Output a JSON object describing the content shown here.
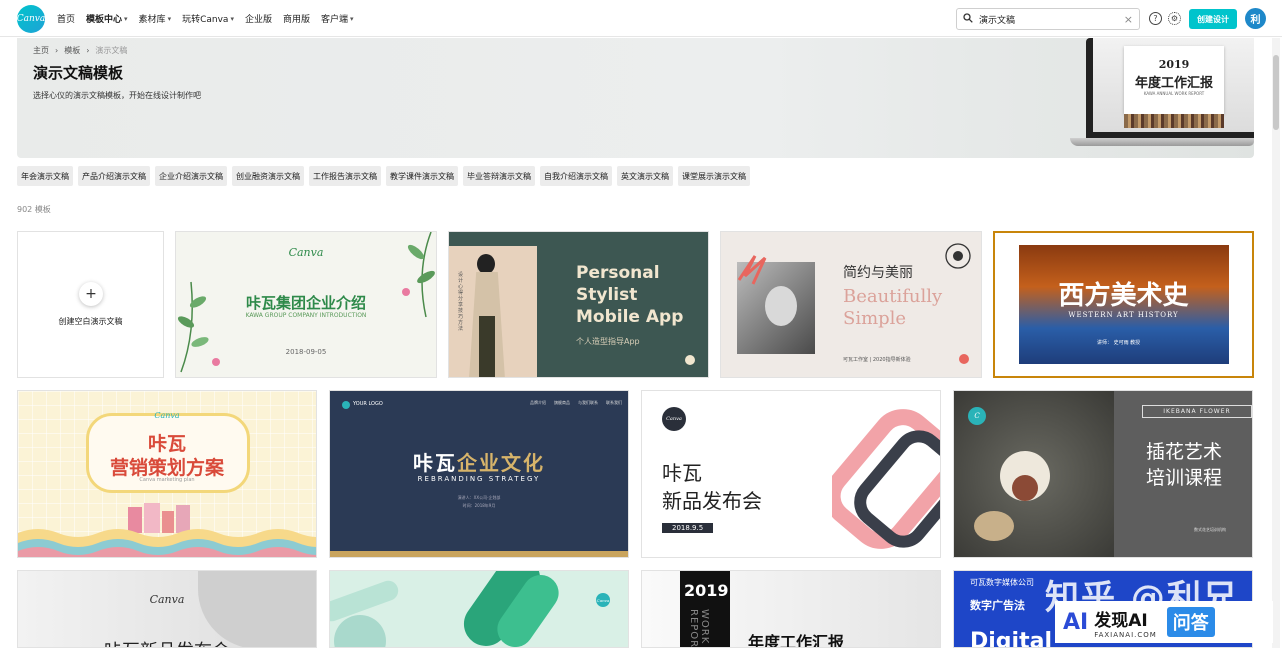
{
  "nav": {
    "logo_text": "Canva",
    "items": [
      {
        "label": "首页",
        "has_chevron": false
      },
      {
        "label": "模板中心",
        "has_chevron": true,
        "active": true
      },
      {
        "label": "素材库",
        "has_chevron": true
      },
      {
        "label": "玩转Canva",
        "has_chevron": true
      },
      {
        "label": "企业版",
        "has_chevron": false
      },
      {
        "label": "商用版",
        "has_chevron": false
      },
      {
        "label": "客户端",
        "has_chevron": true
      }
    ],
    "search_value": "演示文稿",
    "create_button": "创建设计",
    "avatar_initial": "利"
  },
  "hero": {
    "breadcrumbs": [
      "主页",
      "模板",
      "演示文稿"
    ],
    "title": "演示文稿模板",
    "subtitle": "选择心仪的演示文稿模板，开始在线设计制作吧",
    "laptop_year": "2019",
    "laptop_title": "年度工作汇报",
    "laptop_sub": "KAWA ANNUAL WORK REPORT"
  },
  "tags": [
    "年会演示文稿",
    "产品介绍演示文稿",
    "企业介绍演示文稿",
    "创业融资演示文稿",
    "工作报告演示文稿",
    "教学课件演示文稿",
    "毕业答辩演示文稿",
    "自我介绍演示文稿",
    "英文演示文稿",
    "课堂展示演示文稿"
  ],
  "result_count": "902 模板",
  "blank_card": {
    "label": "创建空白演示文稿",
    "plus": "+"
  },
  "cards": {
    "c1": {
      "brand": "Canva",
      "title": "咔瓦集团企业介绍",
      "sub": "KAWA GROUP COMPANY INTRODUCTION",
      "date": "2018-09-05"
    },
    "c2": {
      "title_lines": [
        "Personal",
        "Stylist",
        "Mobile App"
      ],
      "sub": "个人造型指导App",
      "side": "设计心得分享技巧方法"
    },
    "c3": {
      "title_cn": "简约与美丽",
      "title_en1": "Beautifully",
      "title_en2": "Simple",
      "footer": "可瓦工作室 | 2020指导新体验"
    },
    "c4": {
      "title": "西方美术史",
      "sub": "WESTERN ART HISTORY",
      "footer": "讲师：  史可雨  教授"
    },
    "c5": {
      "brand": "Canva",
      "title1": "咔瓦",
      "title2": "营销策划方案",
      "sub": "Canva marketing plan"
    },
    "c6": {
      "logo": "YOUR LOGO",
      "menu": [
        "品牌介绍",
        "旗舰商品",
        "与我们联系",
        "联系我们"
      ],
      "title_a": "咔瓦",
      "title_b": "企业文化",
      "sub": "REBRANDING STRATEGY",
      "meta1": "演讲人：XX公司·企划部",
      "meta2": "时间：2018年9月"
    },
    "c7": {
      "brand": "Canva",
      "title1": "咔瓦",
      "title2": "新品发布会",
      "date": "2018.9.5"
    },
    "c8": {
      "brand": "C",
      "tag": "IKEBANA FLOWER",
      "title1": "插花艺术",
      "title2": "培训课程",
      "footer": "数式花艺培训机构"
    },
    "c9": {
      "brand": "Canva",
      "title": "咔瓦新品发布会"
    },
    "c10": {
      "brand": "Canva"
    },
    "c11": {
      "year": "2019",
      "side": "WORK REPORT",
      "title": "年度工作汇报"
    },
    "c12": {
      "company": "可瓦数字媒体公司",
      "title": "数字广告法",
      "sub": "Digital"
    }
  },
  "watermark": {
    "text": "知乎 @利兄",
    "badge_ai": "AI",
    "badge_big": "发现AI",
    "badge_small": "FAXIANAI.COM",
    "badge_q": "问答"
  }
}
